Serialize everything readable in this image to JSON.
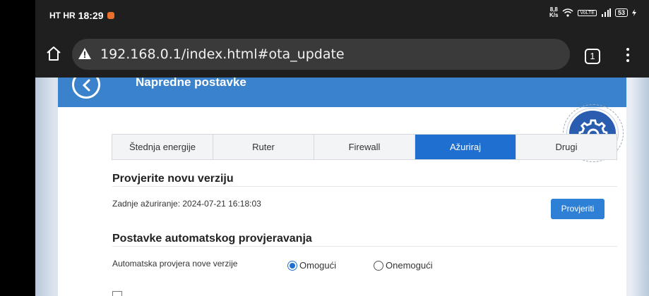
{
  "status_bar": {
    "carrier": "HT HR",
    "time": "18:29",
    "speed_value": "8,8",
    "speed_unit": "K/s",
    "volte": "VoLTE",
    "battery": "53"
  },
  "browser": {
    "url": "192.168.0.1/index.html#ota_update",
    "tab_count": "1"
  },
  "page": {
    "header_title": "Napredne postavke",
    "tabs": [
      {
        "label": "Štednja energije",
        "active": false
      },
      {
        "label": "Ruter",
        "active": false
      },
      {
        "label": "Firewall",
        "active": false
      },
      {
        "label": "Ažuriraj",
        "active": true
      },
      {
        "label": "Drugi",
        "active": false
      }
    ],
    "check_section": {
      "title": "Provjerite novu verziju",
      "last_update": "Zadnje ažuriranje: 2024-07-21 16:18:03",
      "button_label": "Provjeriti"
    },
    "auto_section": {
      "title": "Postavke automatskog provjeravanja",
      "row_label": "Automatska provjera nove verzije",
      "options": [
        {
          "label": "Omogući",
          "checked": true
        },
        {
          "label": "Onemogući",
          "checked": false
        }
      ]
    }
  },
  "colors": {
    "accent": "#1f6fd0",
    "header_blue": "#3b82cc",
    "button_blue": "#2e7fd6",
    "gear_blue": "#2a5db0"
  }
}
